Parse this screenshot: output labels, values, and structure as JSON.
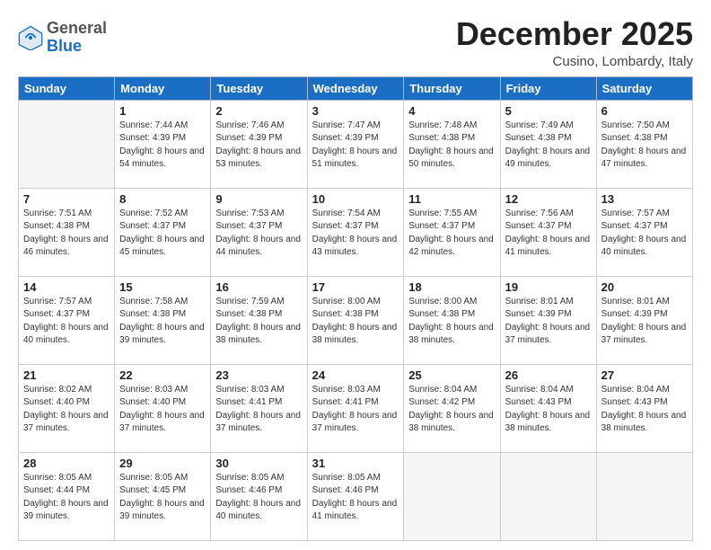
{
  "header": {
    "logo_general": "General",
    "logo_blue": "Blue",
    "month_title": "December 2025",
    "location": "Cusino, Lombardy, Italy"
  },
  "days_of_week": [
    "Sunday",
    "Monday",
    "Tuesday",
    "Wednesday",
    "Thursday",
    "Friday",
    "Saturday"
  ],
  "weeks": [
    [
      {
        "day": "",
        "empty": true
      },
      {
        "day": "1",
        "sunrise": "7:44 AM",
        "sunset": "4:39 PM",
        "daylight": "8 hours and 54 minutes."
      },
      {
        "day": "2",
        "sunrise": "7:46 AM",
        "sunset": "4:39 PM",
        "daylight": "8 hours and 53 minutes."
      },
      {
        "day": "3",
        "sunrise": "7:47 AM",
        "sunset": "4:39 PM",
        "daylight": "8 hours and 51 minutes."
      },
      {
        "day": "4",
        "sunrise": "7:48 AM",
        "sunset": "4:38 PM",
        "daylight": "8 hours and 50 minutes."
      },
      {
        "day": "5",
        "sunrise": "7:49 AM",
        "sunset": "4:38 PM",
        "daylight": "8 hours and 49 minutes."
      },
      {
        "day": "6",
        "sunrise": "7:50 AM",
        "sunset": "4:38 PM",
        "daylight": "8 hours and 47 minutes."
      }
    ],
    [
      {
        "day": "7",
        "sunrise": "7:51 AM",
        "sunset": "4:38 PM",
        "daylight": "8 hours and 46 minutes."
      },
      {
        "day": "8",
        "sunrise": "7:52 AM",
        "sunset": "4:37 PM",
        "daylight": "8 hours and 45 minutes."
      },
      {
        "day": "9",
        "sunrise": "7:53 AM",
        "sunset": "4:37 PM",
        "daylight": "8 hours and 44 minutes."
      },
      {
        "day": "10",
        "sunrise": "7:54 AM",
        "sunset": "4:37 PM",
        "daylight": "8 hours and 43 minutes."
      },
      {
        "day": "11",
        "sunrise": "7:55 AM",
        "sunset": "4:37 PM",
        "daylight": "8 hours and 42 minutes."
      },
      {
        "day": "12",
        "sunrise": "7:56 AM",
        "sunset": "4:37 PM",
        "daylight": "8 hours and 41 minutes."
      },
      {
        "day": "13",
        "sunrise": "7:57 AM",
        "sunset": "4:37 PM",
        "daylight": "8 hours and 40 minutes."
      }
    ],
    [
      {
        "day": "14",
        "sunrise": "7:57 AM",
        "sunset": "4:37 PM",
        "daylight": "8 hours and 40 minutes."
      },
      {
        "day": "15",
        "sunrise": "7:58 AM",
        "sunset": "4:38 PM",
        "daylight": "8 hours and 39 minutes."
      },
      {
        "day": "16",
        "sunrise": "7:59 AM",
        "sunset": "4:38 PM",
        "daylight": "8 hours and 38 minutes."
      },
      {
        "day": "17",
        "sunrise": "8:00 AM",
        "sunset": "4:38 PM",
        "daylight": "8 hours and 38 minutes."
      },
      {
        "day": "18",
        "sunrise": "8:00 AM",
        "sunset": "4:38 PM",
        "daylight": "8 hours and 38 minutes."
      },
      {
        "day": "19",
        "sunrise": "8:01 AM",
        "sunset": "4:39 PM",
        "daylight": "8 hours and 37 minutes."
      },
      {
        "day": "20",
        "sunrise": "8:01 AM",
        "sunset": "4:39 PM",
        "daylight": "8 hours and 37 minutes."
      }
    ],
    [
      {
        "day": "21",
        "sunrise": "8:02 AM",
        "sunset": "4:40 PM",
        "daylight": "8 hours and 37 minutes."
      },
      {
        "day": "22",
        "sunrise": "8:03 AM",
        "sunset": "4:40 PM",
        "daylight": "8 hours and 37 minutes."
      },
      {
        "day": "23",
        "sunrise": "8:03 AM",
        "sunset": "4:41 PM",
        "daylight": "8 hours and 37 minutes."
      },
      {
        "day": "24",
        "sunrise": "8:03 AM",
        "sunset": "4:41 PM",
        "daylight": "8 hours and 37 minutes."
      },
      {
        "day": "25",
        "sunrise": "8:04 AM",
        "sunset": "4:42 PM",
        "daylight": "8 hours and 38 minutes."
      },
      {
        "day": "26",
        "sunrise": "8:04 AM",
        "sunset": "4:43 PM",
        "daylight": "8 hours and 38 minutes."
      },
      {
        "day": "27",
        "sunrise": "8:04 AM",
        "sunset": "4:43 PM",
        "daylight": "8 hours and 38 minutes."
      }
    ],
    [
      {
        "day": "28",
        "sunrise": "8:05 AM",
        "sunset": "4:44 PM",
        "daylight": "8 hours and 39 minutes."
      },
      {
        "day": "29",
        "sunrise": "8:05 AM",
        "sunset": "4:45 PM",
        "daylight": "8 hours and 39 minutes."
      },
      {
        "day": "30",
        "sunrise": "8:05 AM",
        "sunset": "4:46 PM",
        "daylight": "8 hours and 40 minutes."
      },
      {
        "day": "31",
        "sunrise": "8:05 AM",
        "sunset": "4:46 PM",
        "daylight": "8 hours and 41 minutes."
      },
      {
        "day": "",
        "empty": true
      },
      {
        "day": "",
        "empty": true
      },
      {
        "day": "",
        "empty": true
      }
    ]
  ]
}
